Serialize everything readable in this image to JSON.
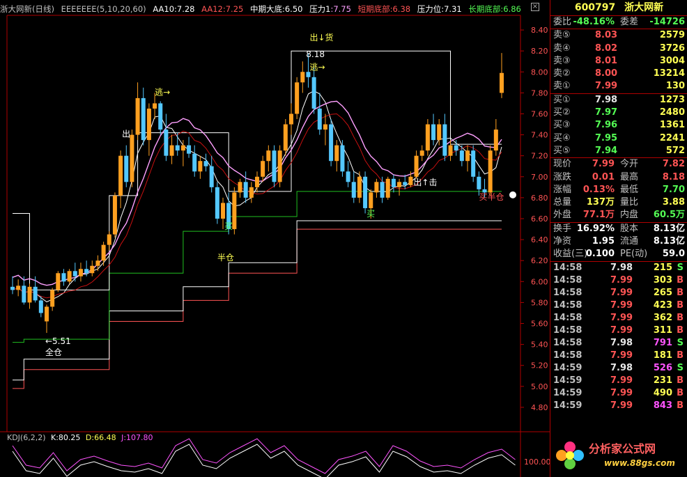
{
  "title_bar": {
    "name": "浙大网新(日线)",
    "indicator": "EEEEEEE(5,10,20,60)",
    "aa10": "AA10:7.28",
    "aa12": "AA12:7.25",
    "zhongqi": "中期大底:6.50",
    "yali1": "压力1",
    "yali1_val": ":7.75",
    "duanqi": "短期底部:6.38",
    "yaliwei": "压力位:7.31",
    "changqi": "长期底部:6.86",
    "close_glyph": "×"
  },
  "y_axis": {
    "labels": [
      "8.40",
      "8.20",
      "8.00",
      "7.80",
      "7.60",
      "7.40",
      "7.20",
      "7.00",
      "6.80",
      "6.60",
      "6.40",
      "6.20",
      "6.00",
      "5.80",
      "5.60",
      "5.40",
      "5.20",
      "5.00",
      "4.80"
    ],
    "range": [
      4.7,
      8.5
    ]
  },
  "chart_data": {
    "type": "candlestick",
    "title": "浙大网新(日线)",
    "ylim": [
      4.7,
      8.5
    ],
    "candles": [
      {
        "o": 5.95,
        "h": 6.05,
        "l": 5.88,
        "c": 5.92
      },
      {
        "o": 5.92,
        "h": 6.02,
        "l": 5.86,
        "c": 5.96
      },
      {
        "o": 5.96,
        "h": 6.05,
        "l": 5.78,
        "c": 5.8
      },
      {
        "o": 5.8,
        "h": 5.98,
        "l": 5.74,
        "c": 5.95
      },
      {
        "o": 5.95,
        "h": 6.05,
        "l": 5.8,
        "c": 5.82
      },
      {
        "o": 5.82,
        "h": 5.86,
        "l": 5.66,
        "c": 5.7
      },
      {
        "o": 5.62,
        "h": 5.78,
        "l": 5.51,
        "c": 5.76
      },
      {
        "o": 5.76,
        "h": 5.94,
        "l": 5.72,
        "c": 5.92
      },
      {
        "o": 5.92,
        "h": 6.1,
        "l": 5.9,
        "c": 6.08
      },
      {
        "o": 6.08,
        "h": 6.12,
        "l": 5.96,
        "c": 6.0
      },
      {
        "o": 6.0,
        "h": 6.12,
        "l": 5.98,
        "c": 6.1
      },
      {
        "o": 6.1,
        "h": 6.18,
        "l": 6.0,
        "c": 6.05
      },
      {
        "o": 6.05,
        "h": 6.18,
        "l": 6.0,
        "c": 6.12
      },
      {
        "o": 6.12,
        "h": 6.2,
        "l": 6.05,
        "c": 6.08
      },
      {
        "o": 6.08,
        "h": 6.2,
        "l": 6.05,
        "c": 6.15
      },
      {
        "o": 6.15,
        "h": 6.25,
        "l": 6.1,
        "c": 6.2
      },
      {
        "o": 6.2,
        "h": 6.38,
        "l": 6.15,
        "c": 6.35
      },
      {
        "o": 6.35,
        "h": 6.48,
        "l": 6.3,
        "c": 6.45
      },
      {
        "o": 6.45,
        "h": 6.85,
        "l": 6.42,
        "c": 6.82
      },
      {
        "o": 6.82,
        "h": 7.25,
        "l": 6.7,
        "c": 7.2
      },
      {
        "o": 7.2,
        "h": 7.3,
        "l": 6.9,
        "c": 6.95
      },
      {
        "o": 6.95,
        "h": 7.45,
        "l": 6.9,
        "c": 7.4
      },
      {
        "o": 7.4,
        "h": 7.9,
        "l": 7.35,
        "c": 7.75
      },
      {
        "o": 7.75,
        "h": 7.85,
        "l": 7.3,
        "c": 7.35
      },
      {
        "o": 7.35,
        "h": 7.7,
        "l": 7.2,
        "c": 7.65
      },
      {
        "o": 7.65,
        "h": 7.8,
        "l": 7.55,
        "c": 7.7
      },
      {
        "o": 7.7,
        "h": 7.72,
        "l": 7.4,
        "c": 7.45
      },
      {
        "o": 7.45,
        "h": 7.6,
        "l": 7.15,
        "c": 7.2
      },
      {
        "o": 7.2,
        "h": 7.4,
        "l": 7.12,
        "c": 7.3
      },
      {
        "o": 7.3,
        "h": 7.42,
        "l": 7.2,
        "c": 7.25
      },
      {
        "o": 7.25,
        "h": 7.35,
        "l": 7.1,
        "c": 7.3
      },
      {
        "o": 7.3,
        "h": 7.38,
        "l": 7.18,
        "c": 7.22
      },
      {
        "o": 7.22,
        "h": 7.3,
        "l": 7.0,
        "c": 7.05
      },
      {
        "o": 7.05,
        "h": 7.2,
        "l": 6.98,
        "c": 7.15
      },
      {
        "o": 7.15,
        "h": 7.22,
        "l": 7.05,
        "c": 7.1
      },
      {
        "o": 7.1,
        "h": 7.2,
        "l": 6.85,
        "c": 6.9
      },
      {
        "o": 6.9,
        "h": 6.95,
        "l": 6.55,
        "c": 6.6
      },
      {
        "o": 6.6,
        "h": 6.8,
        "l": 6.5,
        "c": 6.75
      },
      {
        "o": 6.75,
        "h": 6.85,
        "l": 6.45,
        "c": 6.5
      },
      {
        "o": 6.5,
        "h": 6.9,
        "l": 6.45,
        "c": 6.85
      },
      {
        "o": 6.85,
        "h": 6.98,
        "l": 6.8,
        "c": 6.95
      },
      {
        "o": 6.95,
        "h": 7.05,
        "l": 6.75,
        "c": 6.8
      },
      {
        "o": 6.8,
        "h": 6.95,
        "l": 6.75,
        "c": 6.9
      },
      {
        "o": 6.9,
        "h": 7.05,
        "l": 6.85,
        "c": 7.0
      },
      {
        "o": 7.0,
        "h": 7.2,
        "l": 6.95,
        "c": 7.15
      },
      {
        "o": 7.15,
        "h": 7.3,
        "l": 7.05,
        "c": 7.25
      },
      {
        "o": 7.25,
        "h": 7.3,
        "l": 6.9,
        "c": 6.95
      },
      {
        "o": 6.95,
        "h": 7.3,
        "l": 6.9,
        "c": 7.25
      },
      {
        "o": 7.25,
        "h": 7.55,
        "l": 7.2,
        "c": 7.5
      },
      {
        "o": 7.5,
        "h": 7.7,
        "l": 7.4,
        "c": 7.6
      },
      {
        "o": 7.6,
        "h": 7.95,
        "l": 7.55,
        "c": 7.9
      },
      {
        "o": 7.9,
        "h": 8.1,
        "l": 7.8,
        "c": 8.0
      },
      {
        "o": 8.0,
        "h": 8.18,
        "l": 7.85,
        "c": 7.95
      },
      {
        "o": 7.95,
        "h": 8.05,
        "l": 7.6,
        "c": 7.65
      },
      {
        "o": 7.65,
        "h": 7.8,
        "l": 7.4,
        "c": 7.45
      },
      {
        "o": 7.45,
        "h": 7.6,
        "l": 7.3,
        "c": 7.5
      },
      {
        "o": 7.5,
        "h": 7.55,
        "l": 7.1,
        "c": 7.15
      },
      {
        "o": 7.15,
        "h": 7.35,
        "l": 7.05,
        "c": 7.3
      },
      {
        "o": 7.3,
        "h": 7.35,
        "l": 7.0,
        "c": 7.05
      },
      {
        "o": 7.05,
        "h": 7.15,
        "l": 6.9,
        "c": 6.95
      },
      {
        "o": 6.95,
        "h": 7.05,
        "l": 6.75,
        "c": 6.8
      },
      {
        "o": 6.8,
        "h": 7.05,
        "l": 6.75,
        "c": 7.0
      },
      {
        "o": 7.0,
        "h": 7.05,
        "l": 6.65,
        "c": 6.7
      },
      {
        "o": 6.7,
        "h": 6.88,
        "l": 6.6,
        "c": 6.85
      },
      {
        "o": 6.85,
        "h": 6.98,
        "l": 6.8,
        "c": 6.95
      },
      {
        "o": 6.95,
        "h": 7.0,
        "l": 6.75,
        "c": 6.8
      },
      {
        "o": 6.8,
        "h": 7.0,
        "l": 6.78,
        "c": 6.98
      },
      {
        "o": 6.98,
        "h": 7.02,
        "l": 6.85,
        "c": 6.9
      },
      {
        "o": 6.9,
        "h": 6.98,
        "l": 6.82,
        "c": 6.95
      },
      {
        "o": 6.95,
        "h": 7.02,
        "l": 6.88,
        "c": 6.92
      },
      {
        "o": 6.92,
        "h": 7.05,
        "l": 6.9,
        "c": 7.0
      },
      {
        "o": 7.0,
        "h": 7.25,
        "l": 6.98,
        "c": 7.2
      },
      {
        "o": 7.2,
        "h": 7.3,
        "l": 7.15,
        "c": 7.25
      },
      {
        "o": 7.25,
        "h": 7.55,
        "l": 7.2,
        "c": 7.5
      },
      {
        "o": 7.5,
        "h": 7.6,
        "l": 7.3,
        "c": 7.35
      },
      {
        "o": 7.35,
        "h": 7.55,
        "l": 7.3,
        "c": 7.5
      },
      {
        "o": 7.5,
        "h": 7.6,
        "l": 7.15,
        "c": 7.2
      },
      {
        "o": 7.2,
        "h": 7.35,
        "l": 7.15,
        "c": 7.3
      },
      {
        "o": 7.3,
        "h": 7.35,
        "l": 7.2,
        "c": 7.25
      },
      {
        "o": 7.25,
        "h": 7.3,
        "l": 7.1,
        "c": 7.15
      },
      {
        "o": 7.15,
        "h": 7.3,
        "l": 7.05,
        "c": 7.25
      },
      {
        "o": 7.25,
        "h": 7.3,
        "l": 6.95,
        "c": 7.0
      },
      {
        "o": 7.0,
        "h": 7.05,
        "l": 6.82,
        "c": 6.88
      },
      {
        "o": 6.88,
        "h": 6.98,
        "l": 6.8,
        "c": 6.85
      },
      {
        "o": 6.85,
        "h": 7.3,
        "l": 6.82,
        "c": 7.25
      },
      {
        "o": 7.25,
        "h": 7.55,
        "l": 7.2,
        "c": 7.45
      },
      {
        "o": 7.8,
        "h": 8.18,
        "l": 7.75,
        "c": 7.99
      }
    ],
    "annotations": [
      "←5.51",
      "全仓",
      "出",
      "逃→",
      "买",
      "半仓",
      "出↓货",
      "8.18",
      "逃→",
      "买",
      "出↑击",
      "买半仓"
    ]
  },
  "kdj": {
    "title": "KDJ(6,2,2)",
    "k": "K:80.25",
    "d": "D:66.48",
    "j": "J:107.80",
    "axis_label": "100.00"
  },
  "panel": {
    "code": "600797",
    "name": "浙大网新",
    "weibi_label": "委比",
    "weibi": "-48.16%",
    "weicha_label": "委差",
    "weicha": "-14726",
    "asks": [
      {
        "label": "卖⑤",
        "price": "8.03",
        "vol": "2579"
      },
      {
        "label": "卖④",
        "price": "8.02",
        "vol": "3726"
      },
      {
        "label": "卖③",
        "price": "8.01",
        "vol": "3004"
      },
      {
        "label": "卖②",
        "price": "8.00",
        "vol": "13214"
      },
      {
        "label": "卖①",
        "price": "7.99",
        "vol": "130"
      }
    ],
    "bids": [
      {
        "label": "买①",
        "price": "7.98",
        "vol": "1273"
      },
      {
        "label": "买②",
        "price": "7.97",
        "vol": "2480"
      },
      {
        "label": "买③",
        "price": "7.96",
        "vol": "1361"
      },
      {
        "label": "买④",
        "price": "7.95",
        "vol": "2241"
      },
      {
        "label": "买⑤",
        "price": "7.94",
        "vol": "572"
      }
    ],
    "quote": [
      {
        "l1": "现价",
        "v1": "7.99",
        "l2": "今开",
        "v2": "7.82"
      },
      {
        "l1": "涨跌",
        "v1": "0.01",
        "l2": "最高",
        "v2": "8.18"
      },
      {
        "l1": "涨幅",
        "v1": "0.13%",
        "l2": "最低",
        "v2": "7.70"
      },
      {
        "l1": "总量",
        "v1": "137万",
        "l2": "量比",
        "v2": "3.88"
      },
      {
        "l1": "外盘",
        "v1": "77.1万",
        "l2": "内盘",
        "v2": "60.5万"
      }
    ],
    "stats": [
      {
        "l1": "换手",
        "v1": "16.92%",
        "l2": "股本",
        "v2": "8.13亿"
      },
      {
        "l1": "净资",
        "v1": "1.95",
        "l2": "流通",
        "v2": "8.13亿"
      },
      {
        "l1": "收益(三)",
        "v1": "0.100",
        "l2": "PE(动)",
        "v2": "59.0"
      }
    ],
    "ticks": [
      {
        "t": "14:58",
        "p": "7.98",
        "q": "215",
        "bs": "S"
      },
      {
        "t": "14:58",
        "p": "7.99",
        "q": "303",
        "bs": "B"
      },
      {
        "t": "14:58",
        "p": "7.99",
        "q": "265",
        "bs": "B"
      },
      {
        "t": "14:58",
        "p": "7.99",
        "q": "423",
        "bs": "B"
      },
      {
        "t": "14:58",
        "p": "7.99",
        "q": "362",
        "bs": "B"
      },
      {
        "t": "14:58",
        "p": "7.99",
        "q": "311",
        "bs": "B"
      },
      {
        "t": "14:58",
        "p": "7.98",
        "q": "791",
        "bs": "S"
      },
      {
        "t": "14:58",
        "p": "7.99",
        "q": "181",
        "bs": "B"
      },
      {
        "t": "14:59",
        "p": "7.98",
        "q": "526",
        "bs": "S"
      },
      {
        "t": "14:59",
        "p": "7.99",
        "q": "231",
        "bs": "B"
      },
      {
        "t": "14:59",
        "p": "7.99",
        "q": "490",
        "bs": "B"
      },
      {
        "t": "14:59",
        "p": "7.99",
        "q": "843",
        "bs": "B"
      }
    ]
  },
  "watermark": {
    "text": "分析家公式网",
    "url": "www.88gs.com"
  },
  "colors": {
    "up": "#ff5454",
    "down": "#54c8ff",
    "candle_up_fill": "#ffa020",
    "ma_white": "#ffffff",
    "ma_red": "#c81010",
    "pink": "#ffa0ff",
    "green_line": "#20c020"
  }
}
